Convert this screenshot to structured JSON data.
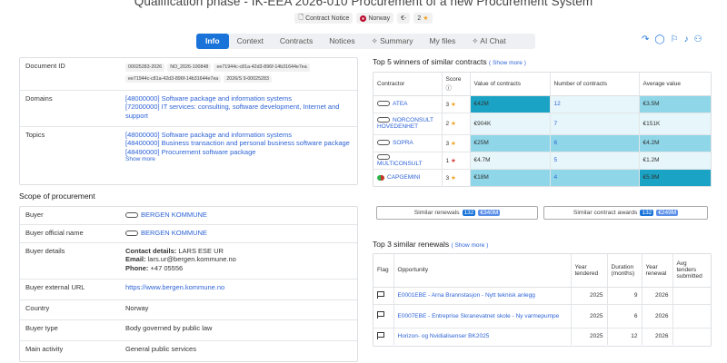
{
  "header": {
    "title": "Qualification phase - IK-EEA 2026-010 Procurement of a new Procurement System",
    "chips": {
      "notice": "Contract Notice",
      "country": "Norway",
      "currency": "€-",
      "rating": "2"
    }
  },
  "tabs": [
    "Info",
    "Context",
    "Contracts",
    "Notices",
    "Summary",
    "My files",
    "AI Chat"
  ],
  "active_tab": "Info",
  "info": {
    "document_id_label": "Document ID",
    "document_ids": [
      "00025283-2026",
      "NO_2026-100848",
      "ee71944c-c81a-42d3-896f-14b31644e7ea",
      "ee71944c-c81a-42d3-896f-14b31644e7ea",
      "2026/S 9-00025283"
    ],
    "domains_label": "Domains",
    "domains": [
      "[48000000] Software package and information systems",
      "[72000000] IT services: consulting, software development, Internet and support"
    ],
    "topics_label": "Topics",
    "topics": [
      "[48000000] Software package and information systems",
      "[48400000] Business transaction and personal business software package",
      "[48490000] Procurement software package"
    ],
    "show_more": "Show more"
  },
  "scope": {
    "title": "Scope of procurement",
    "buyer_label": "Buyer",
    "buyer": "BERGEN KOMMUNE",
    "buyer_official_label": "Buyer official name",
    "buyer_official": "BERGEN KOMMUNE",
    "buyer_details_label": "Buyer details",
    "contact_label": "Contact details:",
    "contact_value": "LARS ESE UR",
    "email_label": "Email:",
    "email_value": "lars.ur@bergen.kommune.no",
    "phone_label": "Phone:",
    "phone_value": "+47 05556",
    "url_label": "Buyer external URL",
    "url": "https://www.bergen.kommune.no",
    "country_label": "Country",
    "country": "Norway",
    "buyer_type_label": "Buyer type",
    "buyer_type": "Body governed by public law",
    "activity_label": "Main activity",
    "activity": "General public services"
  },
  "winners": {
    "title": "Top 5 winners of similar contracts",
    "show_more": "( Show more )",
    "headers": [
      "Contractor",
      "Score",
      "Value of contracts",
      "Number of contracts",
      "Average value"
    ],
    "rows": [
      {
        "name": "ATEA",
        "score": "3",
        "value": "€42M",
        "count": "12",
        "avg": "€3.5M",
        "vfill": 1.0,
        "cfill": 0.0,
        "afill": 0.5
      },
      {
        "name": "NORCONSULT HOVEDENHET",
        "score": "2",
        "value": "€904K",
        "count": "7",
        "avg": "€151K",
        "vfill": 0.0,
        "cfill": 0.0,
        "afill": 0.0
      },
      {
        "name": "SOPRA",
        "score": "3",
        "value": "€25M",
        "count": "6",
        "avg": "€4.2M",
        "vfill": 0.5,
        "cfill": 0.5,
        "afill": 0.7
      },
      {
        "name": "MULTICONSULT",
        "score": "1",
        "value": "€4.7M",
        "count": "5",
        "avg": "€1.2M",
        "vfill": 0.0,
        "cfill": 0.0,
        "afill": 0.0
      },
      {
        "name": "CAPGEMINI",
        "score": "3",
        "value": "€18M",
        "count": "4",
        "avg": "€5.9M",
        "vfill": 0.5,
        "cfill": 0.5,
        "afill": 1.0
      }
    ],
    "colors": {
      "strong": "#1aa3c4",
      "mid": "#8ed6e8",
      "light": "#e6f6fa",
      "none": "#ffffff"
    }
  },
  "similar": {
    "renewals_label": "Similar renewals",
    "renewals_count": "132",
    "renewals_value": "€340M",
    "awards_label": "Similar contract awards",
    "awards_count": "132",
    "awards_value": "€249M"
  },
  "renewals": {
    "title": "Top 3 similar renewals",
    "show_more": "( Show more )",
    "headers": [
      "Flag",
      "Opportunity",
      "Year tendered",
      "Duration (months)",
      "Year renewal",
      "Avg tenders submitted"
    ],
    "rows": [
      {
        "opp": "E0001EBE - Arna Brannstasjon - Nytt teknisk anlegg",
        "year": "2025",
        "dur": "9",
        "renew": "2026",
        "avg": ""
      },
      {
        "opp": "E0007EBE - Entreprise Skranevatnet skole - Ny varmepumpe",
        "year": "2025",
        "dur": "6",
        "renew": "2026",
        "avg": ""
      },
      {
        "opp": "Horizon- og Nvidialisenser BK2025",
        "year": "2025",
        "dur": "12",
        "renew": "2026",
        "avg": ""
      }
    ]
  }
}
